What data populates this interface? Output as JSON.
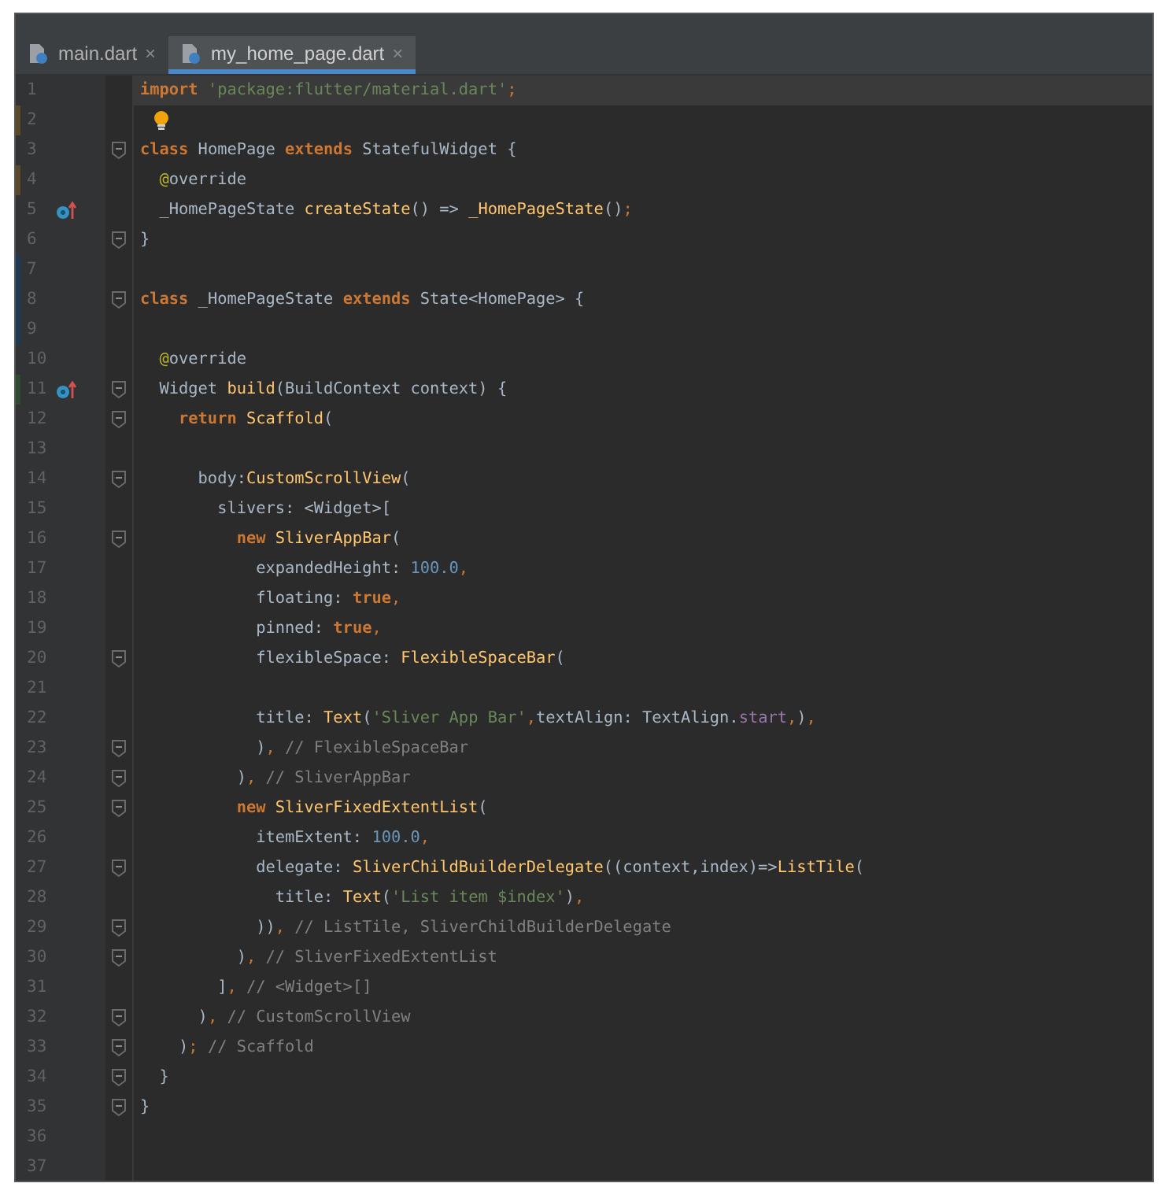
{
  "tabs": [
    {
      "label": "main.dart",
      "selected": false,
      "close": "×"
    },
    {
      "label": "my_home_page.dart",
      "selected": true,
      "close": "×"
    }
  ],
  "editor": {
    "lines": [
      {
        "number": "1",
        "current": true,
        "fold": false,
        "bulb": false,
        "override_marker": false,
        "tokens": [
          {
            "kw": "import"
          },
          {
            "str": " 'package:flutter/material.dart'"
          },
          {
            "punct": ";"
          }
        ]
      },
      {
        "number": "2",
        "current": false,
        "fold": false,
        "bulb": true,
        "override_marker": false,
        "color": "#5a4a2a"
      },
      {
        "number": "3",
        "current": false,
        "fold": true,
        "bulb": false,
        "override_marker": false,
        "tokens": [
          {
            "kw": "class"
          },
          {
            "plain": " HomePage "
          },
          {
            "kw": "extends"
          },
          {
            "plain": " StatefulWidget {"
          }
        ]
      },
      {
        "number": "4",
        "current": false,
        "fold": false,
        "bulb": false,
        "override_marker": false,
        "color": "#5a4a2a",
        "tokens": [
          {
            "ann": "  @"
          },
          {
            "plain": "override"
          }
        ]
      },
      {
        "number": "5",
        "current": false,
        "fold": false,
        "bulb": false,
        "override_marker": true,
        "tokens": [
          {
            "plain": "  _HomePageState "
          },
          {
            "fn": "createState"
          },
          {
            "plain": "() => "
          },
          {
            "fn": "_HomePageState"
          },
          {
            "plain": "()"
          },
          {
            "punct": ";"
          }
        ]
      },
      {
        "number": "6",
        "current": false,
        "fold": true,
        "bulb": false,
        "override_marker": false,
        "tokens": [
          {
            "plain": "}"
          }
        ]
      },
      {
        "number": "7",
        "current": false,
        "fold": false,
        "bulb": false,
        "override_marker": false,
        "color": "#1d3a55"
      },
      {
        "number": "8",
        "current": false,
        "fold": true,
        "bulb": false,
        "override_marker": false,
        "color": "#1d3a55",
        "tokens": [
          {
            "kw": "class"
          },
          {
            "plain": " _HomePageState "
          },
          {
            "kw": "extends"
          },
          {
            "plain": " State<HomePage> {"
          }
        ]
      },
      {
        "number": "9",
        "current": false,
        "fold": false,
        "bulb": false,
        "override_marker": false,
        "color": "#1d3a55"
      },
      {
        "number": "10",
        "current": false,
        "fold": false,
        "bulb": false,
        "override_marker": false,
        "tokens": [
          {
            "ann": "  @"
          },
          {
            "plain": "override"
          }
        ]
      },
      {
        "number": "11",
        "current": false,
        "fold": true,
        "bulb": false,
        "override_marker": true,
        "color": "#2f4a2f",
        "tokens": [
          {
            "plain": "  Widget "
          },
          {
            "fn": "build"
          },
          {
            "plain": "(BuildContext context) {"
          }
        ]
      },
      {
        "number": "12",
        "current": false,
        "fold": true,
        "bulb": false,
        "override_marker": false,
        "tokens": [
          {
            "kw": "    return"
          },
          {
            "fn": " Scaffold"
          },
          {
            "plain": "("
          }
        ]
      },
      {
        "number": "13",
        "current": false,
        "fold": false,
        "bulb": false,
        "override_marker": false
      },
      {
        "number": "14",
        "current": false,
        "fold": true,
        "bulb": false,
        "override_marker": false,
        "tokens": [
          {
            "plain": "      body:"
          },
          {
            "fn": "CustomScrollView"
          },
          {
            "plain": "("
          }
        ]
      },
      {
        "number": "15",
        "current": false,
        "fold": false,
        "bulb": false,
        "override_marker": false,
        "tokens": [
          {
            "plain": "        slivers: <Widget>["
          }
        ]
      },
      {
        "number": "16",
        "current": false,
        "fold": true,
        "bulb": false,
        "override_marker": false,
        "tokens": [
          {
            "kw": "          new"
          },
          {
            "fn": " SliverAppBar"
          },
          {
            "plain": "("
          }
        ]
      },
      {
        "number": "17",
        "current": false,
        "fold": false,
        "bulb": false,
        "override_marker": false,
        "tokens": [
          {
            "plain": "            expandedHeight: "
          },
          {
            "num": "100.0"
          },
          {
            "punct": ","
          }
        ]
      },
      {
        "number": "18",
        "current": false,
        "fold": false,
        "bulb": false,
        "override_marker": false,
        "tokens": [
          {
            "plain": "            floating: "
          },
          {
            "kw": "true"
          },
          {
            "punct": ","
          }
        ]
      },
      {
        "number": "19",
        "current": false,
        "fold": false,
        "bulb": false,
        "override_marker": false,
        "tokens": [
          {
            "plain": "            pinned: "
          },
          {
            "kw": "true"
          },
          {
            "punct": ","
          }
        ]
      },
      {
        "number": "20",
        "current": false,
        "fold": true,
        "bulb": false,
        "override_marker": false,
        "tokens": [
          {
            "plain": "            flexibleSpace: "
          },
          {
            "fn": "FlexibleSpaceBar"
          },
          {
            "plain": "("
          }
        ]
      },
      {
        "number": "21",
        "current": false,
        "fold": false,
        "bulb": false,
        "override_marker": false
      },
      {
        "number": "22",
        "current": false,
        "fold": false,
        "bulb": false,
        "override_marker": false,
        "tokens": [
          {
            "plain": "            title: "
          },
          {
            "fn": "Text"
          },
          {
            "plain": "("
          },
          {
            "str": "'Sliver App Bar'"
          },
          {
            "punct": ","
          },
          {
            "plain": "textAlign: TextAlign."
          },
          {
            "field": "start"
          },
          {
            "punct": ","
          },
          {
            "plain": ")"
          },
          {
            "punct": ","
          }
        ]
      },
      {
        "number": "23",
        "current": false,
        "fold": true,
        "bulb": false,
        "override_marker": false,
        "tokens": [
          {
            "plain": "            )"
          },
          {
            "punct": ","
          },
          {
            "cmt": " // FlexibleSpaceBar"
          }
        ]
      },
      {
        "number": "24",
        "current": false,
        "fold": true,
        "bulb": false,
        "override_marker": false,
        "tokens": [
          {
            "plain": "          )"
          },
          {
            "punct": ","
          },
          {
            "cmt": " // SliverAppBar"
          }
        ]
      },
      {
        "number": "25",
        "current": false,
        "fold": true,
        "bulb": false,
        "override_marker": false,
        "tokens": [
          {
            "kw": "          new"
          },
          {
            "fn": " SliverFixedExtentList"
          },
          {
            "plain": "("
          }
        ]
      },
      {
        "number": "26",
        "current": false,
        "fold": false,
        "bulb": false,
        "override_marker": false,
        "tokens": [
          {
            "plain": "            itemExtent: "
          },
          {
            "num": "100.0"
          },
          {
            "punct": ","
          }
        ]
      },
      {
        "number": "27",
        "current": false,
        "fold": true,
        "bulb": false,
        "override_marker": false,
        "tokens": [
          {
            "plain": "            delegate: "
          },
          {
            "fn": "SliverChildBuilderDelegate"
          },
          {
            "plain": "((context,index)=>"
          },
          {
            "fn": "ListTile"
          },
          {
            "plain": "("
          }
        ]
      },
      {
        "number": "28",
        "current": false,
        "fold": false,
        "bulb": false,
        "override_marker": false,
        "tokens": [
          {
            "plain": "              title: "
          },
          {
            "fn": "Text"
          },
          {
            "plain": "("
          },
          {
            "str": "'List item $index'"
          },
          {
            "plain": ")"
          },
          {
            "punct": ","
          }
        ]
      },
      {
        "number": "29",
        "current": false,
        "fold": true,
        "bulb": false,
        "override_marker": false,
        "tokens": [
          {
            "plain": "            ))"
          },
          {
            "punct": ","
          },
          {
            "cmt": " // ListTile, SliverChildBuilderDelegate"
          }
        ]
      },
      {
        "number": "30",
        "current": false,
        "fold": true,
        "bulb": false,
        "override_marker": false,
        "tokens": [
          {
            "plain": "          )"
          },
          {
            "punct": ","
          },
          {
            "cmt": " // SliverFixedExtentList"
          }
        ]
      },
      {
        "number": "31",
        "current": false,
        "fold": false,
        "bulb": false,
        "override_marker": false,
        "tokens": [
          {
            "plain": "        ]"
          },
          {
            "punct": ","
          },
          {
            "cmt": " // <Widget>[]"
          }
        ]
      },
      {
        "number": "32",
        "current": false,
        "fold": true,
        "bulb": false,
        "override_marker": false,
        "tokens": [
          {
            "plain": "      )"
          },
          {
            "punct": ","
          },
          {
            "cmt": " // CustomScrollView"
          }
        ]
      },
      {
        "number": "33",
        "current": false,
        "fold": true,
        "bulb": false,
        "override_marker": false,
        "tokens": [
          {
            "plain": "    )"
          },
          {
            "punct": ";"
          },
          {
            "cmt": " // Scaffold"
          }
        ]
      },
      {
        "number": "34",
        "current": false,
        "fold": true,
        "bulb": false,
        "override_marker": false,
        "tokens": [
          {
            "plain": "  }"
          }
        ]
      },
      {
        "number": "35",
        "current": false,
        "fold": true,
        "bulb": false,
        "override_marker": false,
        "tokens": [
          {
            "plain": "}"
          }
        ]
      },
      {
        "number": "36",
        "current": false,
        "fold": false,
        "bulb": false,
        "override_marker": false
      },
      {
        "number": "37",
        "current": false,
        "fold": false,
        "bulb": false,
        "override_marker": false
      }
    ]
  }
}
